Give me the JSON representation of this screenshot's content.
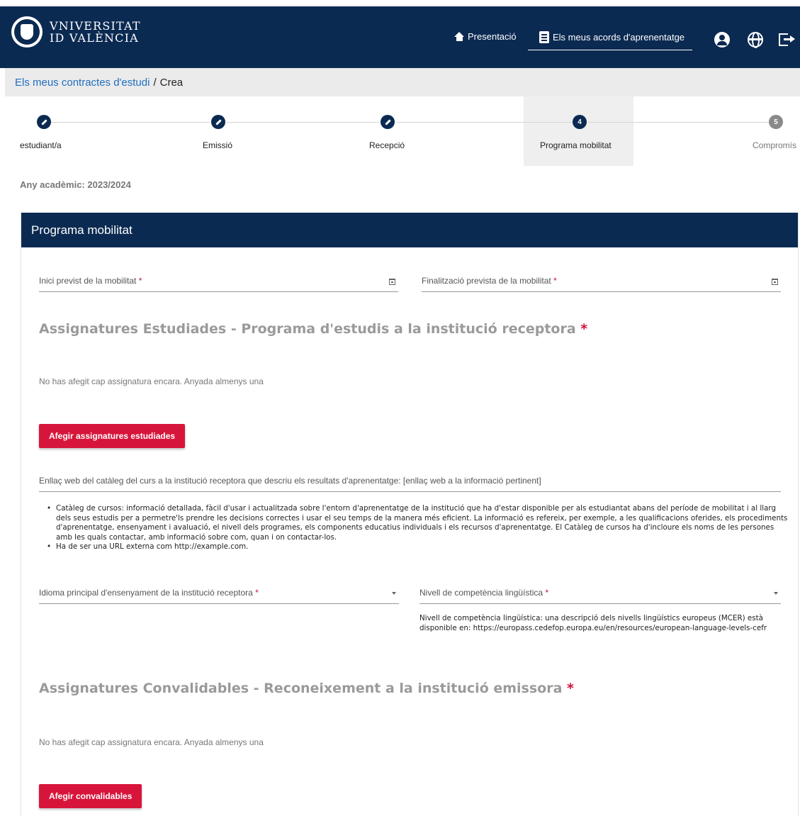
{
  "header": {
    "logo_line1": "VNIVERSITAT",
    "logo_line2": "ID VALÈNCIA",
    "nav_presentacio": "Presentació",
    "nav_acords": "Els meus acords d'aprenentatge",
    "icons": [
      "home-icon",
      "clipboard-icon",
      "user-icon",
      "globe-icon",
      "logout-icon"
    ],
    "brand_color": "#0b2a52"
  },
  "breadcrumb": {
    "link": "Els meus contractes d'estudi",
    "separator": "/",
    "current": "Crea"
  },
  "stepper": {
    "steps": [
      {
        "label": "estudiant/a",
        "marker": "",
        "state": "done"
      },
      {
        "label": "Emissió",
        "marker": "",
        "state": "done"
      },
      {
        "label": "Recepció",
        "marker": "",
        "state": "done"
      },
      {
        "label": "Programa mobilitat",
        "marker": "4",
        "state": "active"
      },
      {
        "label": "Compromís",
        "marker": "5",
        "state": "pending"
      }
    ]
  },
  "academic_year": "Any acadèmic: 2023/2024",
  "card": {
    "title": "Programa mobilitat",
    "start_date_label": "Inici previst de la mobilitat",
    "end_date_label": "Finalització prevista de la mobilitat",
    "required_mark": "*",
    "studied": {
      "title": "Assignatures Estudiades - Programa d'estudis a la institució receptora",
      "empty_message": "No has afegit cap assignatura encara. Anyada almenys una",
      "button": "Afegir assignatures estudiades"
    },
    "catalog_link_label": "Enllaç web del catàleg del curs a la institució receptora que descriu els resultats d'aprenentatge: [enllaç web a la informació pertinent]",
    "catalog_help": [
      "Catàleg de cursos: informació detallada, fàcil d'usar i actualitzada sobre l'entorn d'aprenentatge de la institució que ha d'estar disponible per als estudiantat abans del període de mobilitat i al llarg dels seus estudis per a permetre'ls prendre les decisions correctes i usar el seu temps de la manera més eficient. La informació es refereix, per exemple, a les qualificacions oferides, els procediments d'aprenentatge, ensenyament i avaluació, el nivell dels programes, els components educatius individuals i els recursos d'aprenentatge. El Catàleg de cursos ha d'incloure els noms de les persones amb les quals contactar, amb informació sobre com, quan i on contactar-los.",
      "Ha de ser una URL externa com http://example.com."
    ],
    "language_label": "Idioma principal d'ensenyament de la institució receptora",
    "level_label": "Nivell de competència lingüística",
    "level_help": "Nivell de competència lingüística: una descripció dels nivells lingüístics europeus (MCER) està disponible en: https://europass.cedefop.europa.eu/en/resources/european-language-levels-cefr",
    "convalidables": {
      "title": "Assignatures Convalidables - Reconeixement a la institució emissora",
      "empty_message": "No has afegit cap assignatura encara. Anyada almenys una",
      "button": "Afegir convalidables"
    },
    "accent_color": "#d7153a"
  }
}
